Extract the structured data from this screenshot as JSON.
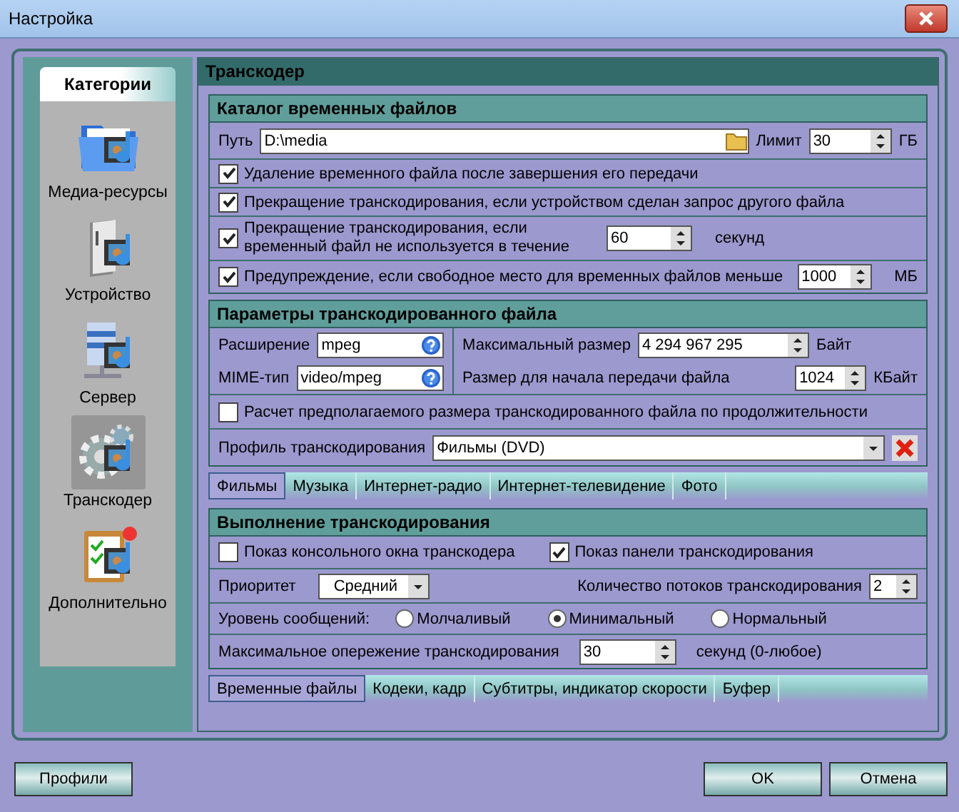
{
  "window": {
    "title": "Настройка"
  },
  "sidebar": {
    "title": "Категории",
    "items": [
      {
        "label": "Медиа-ресурсы",
        "selected": false
      },
      {
        "label": "Устройство",
        "selected": false
      },
      {
        "label": "Сервер",
        "selected": false
      },
      {
        "label": "Транскодер",
        "selected": true
      },
      {
        "label": "Дополнительно",
        "selected": false
      }
    ]
  },
  "panel": {
    "title": "Транскодер"
  },
  "temp_files": {
    "title": "Каталог временных файлов",
    "path_label": "Путь",
    "path_value": "D:\\media",
    "limit_label": "Лимит",
    "limit_value": "30",
    "limit_unit": "ГБ",
    "options": [
      {
        "kind": "plain",
        "label": "Удаление временного файла после завершения его передачи",
        "checked": true
      },
      {
        "kind": "plain",
        "label": "Прекращение транскодирования, если устройством сделан запрос другого файла",
        "checked": true
      },
      {
        "kind": "spin",
        "label": "Прекращение транскодирования, если\nвременный файл не используется в течение",
        "value": "60",
        "unit": "секунд",
        "checked": true
      },
      {
        "kind": "spin",
        "label": "Предупреждение, если свободное место для временных файлов меньше",
        "value": "1000",
        "unit": "МБ",
        "checked": true
      }
    ]
  },
  "file_params": {
    "title": "Параметры транскодированного файла",
    "extension_label": "Расширение",
    "extension_value": "mpeg",
    "mime_label": "MIME-тип",
    "mime_value": "video/mpeg",
    "max_size_label": "Максимальный размер",
    "max_size_value": "4 294 967 295",
    "max_size_unit": "Байт",
    "start_size_label": "Размер для начала передачи файла",
    "start_size_value": "1024",
    "start_size_unit": "КБайт",
    "estimate": {
      "label": "Расчет предполагаемого размера транскодированного файла по продолжительности",
      "checked": false
    },
    "profile_label": "Профиль транскодирования",
    "profile_value": "Фильмы (DVD)"
  },
  "profile_tabs": [
    {
      "label": "Фильмы",
      "selected": true
    },
    {
      "label": "Музыка",
      "selected": false
    },
    {
      "label": "Интернет-радио",
      "selected": false
    },
    {
      "label": "Интернет-телевидение",
      "selected": false
    },
    {
      "label": "Фото",
      "selected": false
    }
  ],
  "execution": {
    "title": "Выполнение транскодирования",
    "console": {
      "label": "Показ консольного окна транскодера",
      "checked": false
    },
    "panel": {
      "label": "Показ панели транскодирования",
      "checked": true
    },
    "priority_label": "Приоритет",
    "priority_value": "Средний",
    "threads_label": "Количество потоков транскодирования",
    "threads_value": "2",
    "level_label": "Уровень сообщений:",
    "levels": [
      {
        "label": "Молчаливый",
        "selected": false
      },
      {
        "label": "Минимальный",
        "selected": true
      },
      {
        "label": "Нормальный",
        "selected": false
      }
    ],
    "lead_label": "Максимальное опережение транскодирования",
    "lead_value": "30",
    "lead_unit": "секунд (0-любое)"
  },
  "bottom_tabs": [
    {
      "label": "Временные файлы",
      "selected": true
    },
    {
      "label": "Кодеки, кадр",
      "selected": false
    },
    {
      "label": "Субтитры, индикатор скорости",
      "selected": false
    },
    {
      "label": "Буфер",
      "selected": false
    }
  ],
  "buttons": {
    "profiles": "Профили",
    "ok": "OK",
    "cancel": "Отмена"
  }
}
